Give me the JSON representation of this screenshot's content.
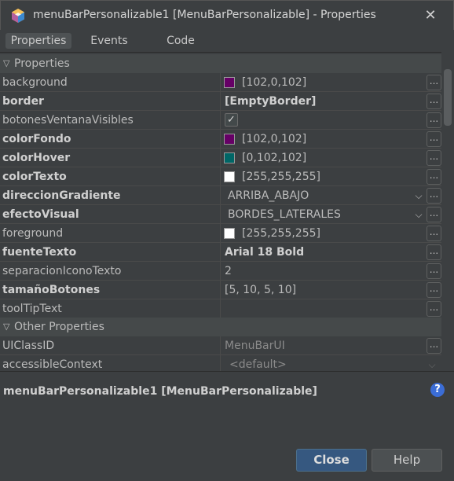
{
  "window": {
    "title": "menuBarPersonalizable1 [MenuBarPersonalizable] - Properties",
    "app_icon": "netbeans-cube-icon",
    "close_glyph": "✕"
  },
  "tabs": [
    {
      "label": "Properties",
      "active": true
    },
    {
      "label": "Events",
      "active": false
    },
    {
      "label": "Code",
      "active": false
    }
  ],
  "sections": {
    "properties": "Properties",
    "other": "Other Properties"
  },
  "props": {
    "background": {
      "name": "background",
      "value": "[102,0,102]",
      "color": "#660066"
    },
    "border": {
      "name": "border",
      "value": "[EmptyBorder]"
    },
    "botones": {
      "name": "botonesVentanaVisibles",
      "checked": true,
      "check_glyph": "✓"
    },
    "colorFondo": {
      "name": "colorFondo",
      "value": "[102,0,102]",
      "color": "#660066"
    },
    "colorHover": {
      "name": "colorHover",
      "value": "[0,102,102]",
      "color": "#006666"
    },
    "colorTexto": {
      "name": "colorTexto",
      "value": "[255,255,255]",
      "color": "#ffffff"
    },
    "direccion": {
      "name": "direccionGradiente",
      "value": "ARRIBA_ABAJO"
    },
    "efecto": {
      "name": "efectoVisual",
      "value": "BORDES_LATERALES"
    },
    "foreground": {
      "name": "foreground",
      "value": "[255,255,255]",
      "color": "#ffffff"
    },
    "fuente": {
      "name": "fuenteTexto",
      "value": "Arial 18 Bold"
    },
    "separacion": {
      "name": "separacionIconoTexto",
      "value": "2"
    },
    "tamano": {
      "name": "tamañoBotones",
      "value": "[5, 10, 5, 10]"
    },
    "tooltip": {
      "name": "toolTipText",
      "value": ""
    }
  },
  "other": {
    "uiclass": {
      "name": "UIClassID",
      "value": "MenuBarUI"
    },
    "accessible": {
      "name": "accessibleContext",
      "value": "<default>"
    }
  },
  "ellipsis_label": "...",
  "dropdown_glyph": "⌵",
  "description": {
    "title": "menuBarPersonalizable1 [MenuBarPersonalizable]",
    "help_glyph": "?"
  },
  "buttons": {
    "close": "Close",
    "help": "Help"
  }
}
